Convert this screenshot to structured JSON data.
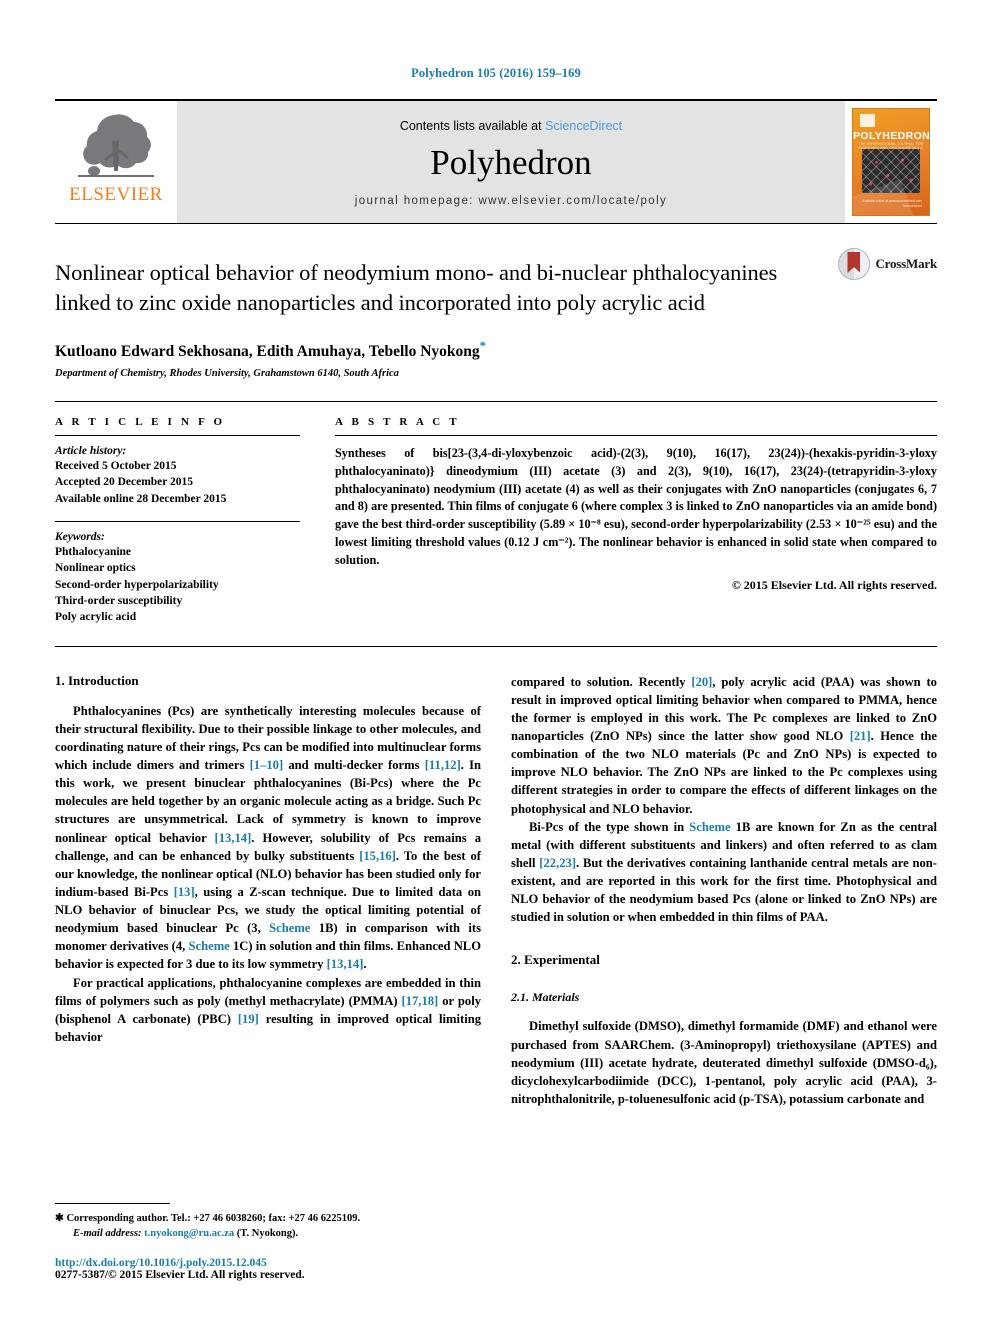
{
  "running_head": "Polyhedron 105 (2016) 159–169",
  "masthead": {
    "publisher": "ELSEVIER",
    "contents_prefix": "Contents lists available at ",
    "contents_link": "ScienceDirect",
    "journal_name": "Polyhedron",
    "homepage": "journal homepage: www.elsevier.com/locate/poly",
    "cover": {
      "title": "POLYHEDRON",
      "subtitle": "THE INTERNATIONAL JOURNAL FOR INORGANIC AND ORGANOMETALLIC CHEMISTRY",
      "footer": "Available online at www.sciencedirect.com\nScienceDirect"
    }
  },
  "crossmark": {
    "label": "CrossMark"
  },
  "article": {
    "title": "Nonlinear optical behavior of neodymium mono- and bi-nuclear phthalocyanines linked to zinc oxide nanoparticles and incorporated into poly acrylic acid",
    "authors": "Kutloano Edward Sekhosana, Edith Amuhaya, Tebello Nyokong",
    "corresponding_marker": "*",
    "affiliation": "Department of Chemistry, Rhodes University, Grahamstown 6140, South Africa"
  },
  "article_info": {
    "label": "A R T I C L E   I N F O",
    "history_head": "Article history:",
    "history": [
      "Received 5 October 2015",
      "Accepted 20 December 2015",
      "Available online 28 December 2015"
    ],
    "keywords_head": "Keywords:",
    "keywords": [
      "Phthalocyanine",
      "Nonlinear optics",
      "Second-order hyperpolarizability",
      "Third-order susceptibility",
      "Poly acrylic acid"
    ]
  },
  "abstract": {
    "label": "A B S T R A C T",
    "text": "Syntheses of bis[23-(3,4-di-yloxybenzoic acid)-(2(3), 9(10), 16(17), 23(24))-(hexakis-pyridin-3-yloxy phthalocyaninato)} dineodymium (III) acetate (3) and 2(3), 9(10), 16(17), 23(24)-(tetrapyridin-3-yloxy phthalocyaninato) neodymium (III) acetate (4) as well as their conjugates with ZnO nanoparticles (conjugates 6, 7 and 8) are presented. Thin films of conjugate 6 (where complex 3 is linked to ZnO nanoparticles via an amide bond) gave the best third-order susceptibility (5.89 × 10⁻⁸ esu), second-order hyperpolarizability (2.53 × 10⁻²⁵ esu) and the lowest limiting threshold values (0.12 J cm⁻²). The nonlinear behavior is enhanced in solid state when compared to solution.",
    "copyright": "© 2015 Elsevier Ltd. All rights reserved."
  },
  "sections": {
    "introduction_heading": "1. Introduction",
    "intro_p1": "Phthalocyanines (Pcs) are synthetically interesting molecules because of their structural flexibility. Due to their possible linkage to other molecules, and coordinating nature of their rings, Pcs can be modified into multinuclear forms which include dimers and trimers [1–10] and multi-decker forms [11,12]. In this work, we present binuclear phthalocyanines (Bi-Pcs) where the Pc molecules are held together by an organic molecule acting as a bridge. Such Pc structures are unsymmetrical. Lack of symmetry is known to improve nonlinear optical behavior [13,14]. However, solubility of Pcs remains a challenge, and can be enhanced by bulky substituents [15,16]. To the best of our knowledge, the nonlinear optical (NLO) behavior has been studied only for indium-based Bi-Pcs [13], using a Z-scan technique. Due to limited data on NLO behavior of binuclear Pcs, we study the optical limiting potential of neodymium based binuclear Pc (3, Scheme 1B) in comparison with its monomer derivatives (4, Scheme 1C) in solution and thin films. Enhanced NLO behavior is expected for 3 due to its low symmetry [13,14].",
    "intro_p2": "For practical applications, phthalocyanine complexes are embedded in thin films of polymers such as poly (methyl methacrylate) (PMMA) [17,18] or poly (bisphenol A carbonate) (PBC) [19] resulting in improved optical limiting behavior",
    "intro_p3": "compared to solution. Recently [20], poly acrylic acid (PAA) was shown to result in improved optical limiting behavior when compared to PMMA, hence the former is employed in this work. The Pc complexes are linked to ZnO nanoparticles (ZnO NPs) since the latter show good NLO [21]. Hence the combination of the two NLO materials (Pc and ZnO NPs) is expected to improve NLO behavior. The ZnO NPs are linked to the Pc complexes using different strategies in order to compare the effects of different linkages on the photophysical and NLO behavior.",
    "intro_p4": "Bi-Pcs of the type shown in Scheme 1B are known for Zn as the central metal (with different substituents and linkers) and often referred to as clam shell [22,23]. But the derivatives containing lanthanide central metals are non-existent, and are reported in this work for the first time. Photophysical and NLO behavior of the neodymium based Pcs (alone or linked to ZnO NPs) are studied in solution or when embedded in thin films of PAA.",
    "experimental_heading": "2. Experimental",
    "materials_heading": "2.1. Materials",
    "materials_p1": "Dimethyl sulfoxide (DMSO), dimethyl formamide (DMF) and ethanol were purchased from SAARChem. (3-Aminopropyl) triethoxysilane (APTES) and neodymium (III) acetate hydrate, deuterated dimethyl sulfoxide (DMSO-d₆), dicyclohexylcarbodiimide (DCC), 1-pentanol, poly acrylic acid (PAA), 3-nitrophthalonitrile, p-toluenesulfonic acid (p-TSA), potassium carbonate and"
  },
  "footnote": {
    "corresponding": "Corresponding author. Tel.: +27 46 6038260; fax: +27 46 6225109.",
    "email_label": "E-mail address:",
    "email": "t.nyokong@ru.ac.za",
    "email_suffix": " (T. Nyokong).",
    "doi": "http://dx.doi.org/10.1016/j.poly.2015.12.045",
    "issn": "0277-5387/© 2015 Elsevier Ltd. All rights reserved."
  },
  "colors": {
    "link": "#1a7ca8",
    "science_direct": "#4a9fd4",
    "elsevier_orange": "#f47c20",
    "crossmark_red": "#b4352b"
  }
}
